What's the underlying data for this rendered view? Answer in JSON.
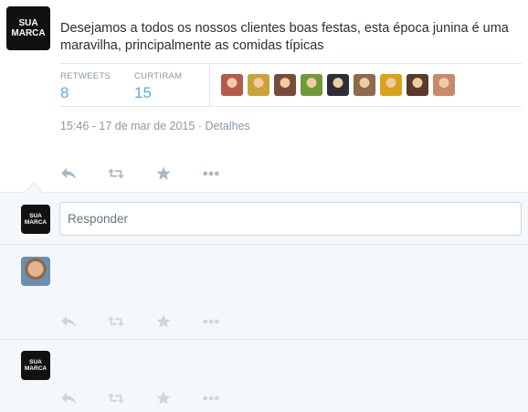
{
  "tweet": {
    "avatar_text": "SUA\nMARCA",
    "text": "Desejamos a todos os nossos clientes boas festas, esta época junina é uma maravilha, principalmente as comidas típicas",
    "stats": {
      "retweets_label": "RETWEETS",
      "retweets_value": "8",
      "favorites_label": "CURTIRAM",
      "favorites_value": "15"
    },
    "favoriters": [
      "#b45a4a",
      "#c9a23a",
      "#7a4b3a",
      "#6f9a3a",
      "#2e2e36",
      "#8c6a4a",
      "#d8a21a",
      "#5a3a2a",
      "#c88a6a"
    ],
    "timestamp": "15:46 - 17 de mar de 2015",
    "details_link": "Detalhes"
  },
  "reply": {
    "avatar_text": "SUA\nMARCA",
    "placeholder": "Responder"
  },
  "conversation": [
    {
      "kind": "person"
    },
    {
      "kind": "brand",
      "avatar_text": "SUA\nMARCA"
    }
  ],
  "action_icons": [
    "reply-icon",
    "retweet-icon",
    "favorite-icon",
    "more-icon"
  ],
  "colors": {
    "accent": "#55acee",
    "muted": "#8899a6",
    "icon": "#aab8c2",
    "panel": "#f5f8fa",
    "border": "#e1e8ed"
  }
}
